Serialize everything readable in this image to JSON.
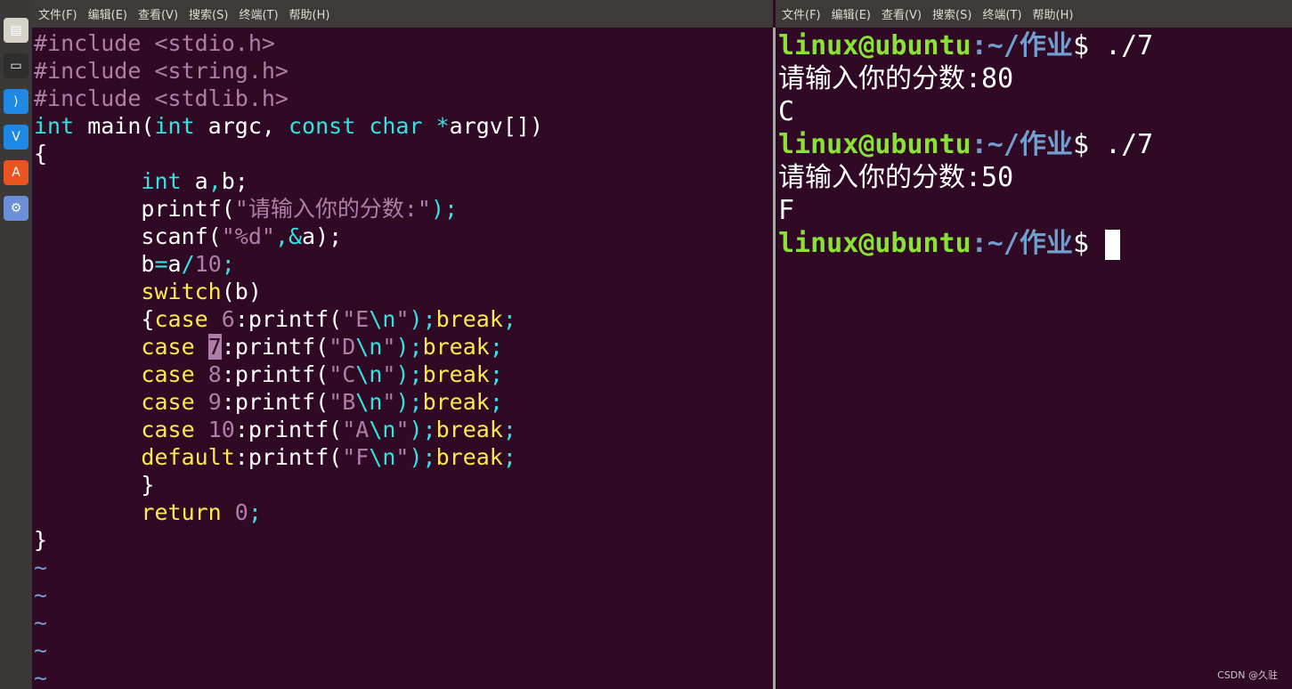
{
  "menus": {
    "left": [
      "文件(F)",
      "编辑(E)",
      "查看(V)",
      "搜索(S)",
      "终端(T)",
      "帮助(H)"
    ],
    "right": [
      "文件(F)",
      "编辑(E)",
      "查看(V)",
      "搜索(S)",
      "终端(T)",
      "帮助(H)"
    ]
  },
  "dock": [
    {
      "icon": "files-icon",
      "color": "#d7d2c8"
    },
    {
      "icon": "terminal-icon",
      "color": "#2e2e2e"
    },
    {
      "icon": "vscode-icon",
      "color": "#1e88e5"
    },
    {
      "icon": "vmware-icon",
      "color": "#1e88e5"
    },
    {
      "icon": "software-center-icon",
      "color": "#e95420"
    },
    {
      "icon": "network-icon",
      "color": "#6a8fd8"
    }
  ],
  "editor": {
    "lines": [
      [
        [
          "#include ",
          "pre"
        ],
        [
          "<stdio.h>",
          "inc"
        ]
      ],
      [
        [
          "#include ",
          "pre"
        ],
        [
          "<string.h>",
          "inc"
        ]
      ],
      [
        [
          "#include ",
          "pre"
        ],
        [
          "<stdlib.h>",
          "inc"
        ]
      ],
      [
        [
          "int",
          "typ"
        ],
        [
          " main(",
          ""
        ],
        [
          "int",
          "typ"
        ],
        [
          " argc, ",
          ""
        ],
        [
          "const",
          "typ"
        ],
        [
          " ",
          ""
        ],
        [
          "char",
          "typ"
        ],
        [
          " ",
          ""
        ],
        [
          "*",
          "op"
        ],
        [
          "argv[])",
          ""
        ]
      ],
      [
        [
          "{",
          ""
        ]
      ],
      [
        [
          "        ",
          ""
        ],
        [
          "int",
          "typ"
        ],
        [
          " a",
          ""
        ],
        [
          ",",
          "op"
        ],
        [
          "b;",
          ""
        ]
      ],
      [
        [
          "        printf(",
          ""
        ],
        [
          "\"请输入你的分数:\"",
          "str"
        ],
        [
          ");",
          "op"
        ]
      ],
      [
        [
          "        scanf(",
          ""
        ],
        [
          "\"%d\"",
          "str"
        ],
        [
          ",&",
          "op"
        ],
        [
          "a);",
          ""
        ]
      ],
      [
        [
          "        b",
          ""
        ],
        [
          "=",
          "op"
        ],
        [
          "a",
          ""
        ],
        [
          "/",
          "op"
        ],
        [
          "10",
          "num"
        ],
        [
          ";",
          "op"
        ]
      ],
      [
        [
          "        ",
          ""
        ],
        [
          "switch",
          "kw"
        ],
        [
          "(b)",
          ""
        ]
      ],
      [
        [
          "        {",
          ""
        ],
        [
          "case",
          "kw"
        ],
        [
          " ",
          ""
        ],
        [
          "6",
          "num"
        ],
        [
          ":printf(",
          ""
        ],
        [
          "\"E",
          "str"
        ],
        [
          "\\n",
          "esc"
        ],
        [
          "\"",
          "str"
        ],
        [
          ");",
          "op"
        ],
        [
          "break",
          "kw"
        ],
        [
          ";",
          "op"
        ]
      ],
      [
        [
          "        ",
          ""
        ],
        [
          "case",
          "kw"
        ],
        [
          " ",
          ""
        ],
        [
          "7",
          "cur"
        ],
        [
          ":printf(",
          ""
        ],
        [
          "\"D",
          "str"
        ],
        [
          "\\n",
          "esc"
        ],
        [
          "\"",
          "str"
        ],
        [
          ");",
          "op"
        ],
        [
          "break",
          "kw"
        ],
        [
          ";",
          "op"
        ]
      ],
      [
        [
          "        ",
          ""
        ],
        [
          "case",
          "kw"
        ],
        [
          " ",
          ""
        ],
        [
          "8",
          "num"
        ],
        [
          ":printf(",
          ""
        ],
        [
          "\"C",
          "str"
        ],
        [
          "\\n",
          "esc"
        ],
        [
          "\"",
          "str"
        ],
        [
          ");",
          "op"
        ],
        [
          "break",
          "kw"
        ],
        [
          ";",
          "op"
        ]
      ],
      [
        [
          "        ",
          ""
        ],
        [
          "case",
          "kw"
        ],
        [
          " ",
          ""
        ],
        [
          "9",
          "num"
        ],
        [
          ":printf(",
          ""
        ],
        [
          "\"B",
          "str"
        ],
        [
          "\\n",
          "esc"
        ],
        [
          "\"",
          "str"
        ],
        [
          ");",
          "op"
        ],
        [
          "break",
          "kw"
        ],
        [
          ";",
          "op"
        ]
      ],
      [
        [
          "        ",
          ""
        ],
        [
          "case",
          "kw"
        ],
        [
          " ",
          ""
        ],
        [
          "10",
          "num"
        ],
        [
          ":printf(",
          ""
        ],
        [
          "\"A",
          "str"
        ],
        [
          "\\n",
          "esc"
        ],
        [
          "\"",
          "str"
        ],
        [
          ");",
          "op"
        ],
        [
          "break",
          "kw"
        ],
        [
          ";",
          "op"
        ]
      ],
      [
        [
          "        ",
          ""
        ],
        [
          "default",
          "kw"
        ],
        [
          ":printf(",
          ""
        ],
        [
          "\"F",
          "str"
        ],
        [
          "\\n",
          "esc"
        ],
        [
          "\"",
          "str"
        ],
        [
          ");",
          "op"
        ],
        [
          "break",
          "kw"
        ],
        [
          ";",
          "op"
        ]
      ],
      [
        [
          "        }",
          ""
        ]
      ],
      [
        [
          "        ",
          ""
        ],
        [
          "return",
          "kw"
        ],
        [
          " ",
          ""
        ],
        [
          "0",
          "num"
        ],
        [
          ";",
          "op"
        ]
      ],
      [
        [
          "}",
          ""
        ]
      ],
      [
        [
          "~",
          "tilde"
        ]
      ],
      [
        [
          "~",
          "tilde"
        ]
      ],
      [
        [
          "~",
          "tilde"
        ]
      ],
      [
        [
          "~",
          "tilde"
        ]
      ],
      [
        [
          "~",
          "tilde"
        ]
      ]
    ]
  },
  "terminal": {
    "user": "linux@ubuntu",
    "path": ":~/作业",
    "lines": [
      {
        "type": "prompt",
        "cmd": "$ ./7"
      },
      {
        "type": "out",
        "text": "请输入你的分数:80"
      },
      {
        "type": "out",
        "text": "C"
      },
      {
        "type": "prompt",
        "cmd": "$ ./7"
      },
      {
        "type": "out",
        "text": "请输入你的分数:50"
      },
      {
        "type": "out",
        "text": "F"
      },
      {
        "type": "prompt",
        "cmd": "$ ",
        "cursor": true
      }
    ]
  },
  "watermark": "CSDN @久驻"
}
